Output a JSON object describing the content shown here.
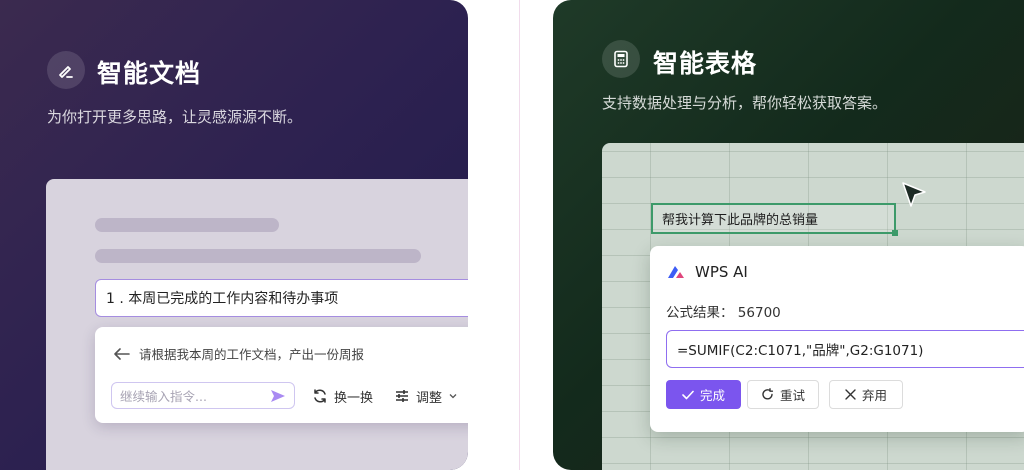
{
  "doc_card": {
    "title": "智能文档",
    "subtitle": "为你打开更多思路，让灵感源源不断。",
    "icon": "pen-icon",
    "doc_line": "1 . 本周已完成的工作内容和待办事项",
    "ai_prompt": "请根据我本周的工作文档，产出一份周报",
    "input_placeholder": "继续输入指令...",
    "swap_label": "换一换",
    "adjust_label": "调整",
    "accent": "#a58de0"
  },
  "sheet_card": {
    "title": "智能表格",
    "subtitle": "支持数据处理与分析，帮你轻松获取答案。",
    "icon": "calculator-icon",
    "cell_text": "帮我计算下此品牌的总销量",
    "popup_title": "WPS AI",
    "result_label": "公式结果：",
    "result_value": "56700",
    "formula": "=SUMIF(C2:C1071,\"品牌\",G2:G1071)",
    "done_label": "完成",
    "retry_label": "重试",
    "discard_label": "弃用",
    "accent": "#7b55ee",
    "selection_color": "#3d9a6a"
  }
}
